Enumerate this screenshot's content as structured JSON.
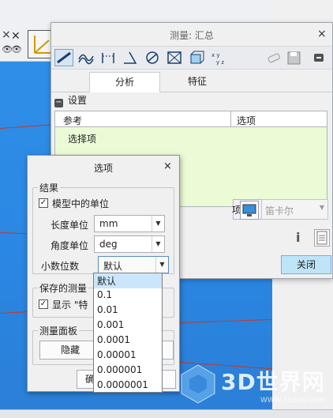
{
  "measure_window": {
    "title": "测量: 汇总",
    "close_glyph": "×",
    "tabs": [
      {
        "label": "分析"
      },
      {
        "label": "特征"
      }
    ],
    "settings_label": "设置",
    "reference_table": {
      "col_ref": "参考",
      "col_option": "选项",
      "placeholder": "选择项"
    },
    "options_field_tail": "项",
    "coord_system": "笛卡尔",
    "close_button": "关闭"
  },
  "options_dialog": {
    "title": "选项",
    "close_glyph": "×",
    "result_group": {
      "label": "结果",
      "model_units": {
        "label": "模型中的单位",
        "checked": true
      },
      "length_unit": {
        "label": "长度单位",
        "value": "mm"
      },
      "angle_unit": {
        "label": "角度单位",
        "value": "deg"
      },
      "decimal_places": {
        "label": "小数位数",
        "value": "默认"
      }
    },
    "saved_group": {
      "label": "保存的测量",
      "show_label": "显示 \"特"
    },
    "panel_group": {
      "label": "测量面板",
      "hide_button": "隐藏"
    },
    "ok_button_partial": "确"
  },
  "decimal_dropdown": {
    "options": [
      "默认",
      "0.1",
      "0.01",
      "0.001",
      "0.0001",
      "0.00001",
      "0.000001",
      "0.0000001"
    ],
    "selected_index": 0
  },
  "watermark": {
    "text": "3D世界网",
    "url": "WWW.3DSJW.COM"
  },
  "colors": {
    "viewport_blue": "#2f8fe8",
    "reference_bg": "#eafbd6",
    "close_button_bg": "#bfe4f8",
    "dropdown_selected": "#cbe6fa"
  }
}
